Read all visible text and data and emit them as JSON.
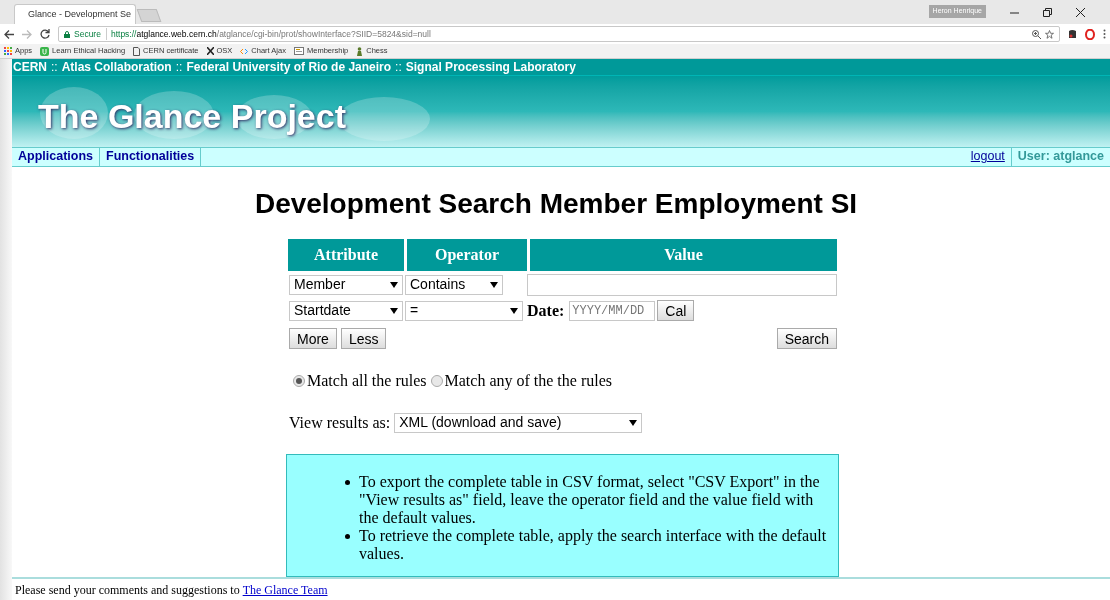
{
  "browser": {
    "tab_title": "Glance - Development Se",
    "profile": "Heron Henrique",
    "secure_label": "Secure",
    "url_scheme": "https://",
    "url_host": "atglance.web.cern.ch",
    "url_path": "/atglance/cgi-bin/prot/showInterface?SIID=5824&sid=null",
    "bookmarks": [
      {
        "kind": "apps",
        "label": "Apps"
      },
      {
        "kind": "badge",
        "label": "Learn Ethical Hacking"
      },
      {
        "kind": "page",
        "label": "CERN certificate"
      },
      {
        "kind": "x",
        "label": "OSX"
      },
      {
        "kind": "code",
        "label": "Chart Ajax"
      },
      {
        "kind": "card",
        "label": "Membership"
      },
      {
        "kind": "pawn",
        "label": "Chess"
      }
    ]
  },
  "header": {
    "credits": [
      {
        "kind": "link",
        "label": "CERN"
      },
      {
        "kind": "sep",
        "label": "::"
      },
      {
        "kind": "link",
        "label": "Atlas Collaboration"
      },
      {
        "kind": "sep",
        "label": "::"
      },
      {
        "kind": "link",
        "label": "Federal University of Rio de Janeiro"
      },
      {
        "kind": "sep",
        "label": "::"
      },
      {
        "kind": "link",
        "label": "Signal Processing Laboratory"
      }
    ],
    "logo_title": "The Glance Project"
  },
  "nav": {
    "items": [
      "Applications",
      "Functionalities"
    ],
    "logout": "logout",
    "user": "User: atglance"
  },
  "title": "Development Search Member Employment SI",
  "search": {
    "columns": [
      "Attribute",
      "Operator",
      "Value"
    ],
    "rows": [
      {
        "attribute": "Member",
        "operator": "Contains",
        "kind": "text"
      },
      {
        "attribute": "Startdate",
        "operator": "=",
        "kind": "date",
        "date_label": "Date:",
        "date_placeholder": "YYYY/MM/DD",
        "cal_button": "Cal"
      }
    ],
    "buttons": [
      "More",
      "Less"
    ],
    "search_button": "Search"
  },
  "match": [
    {
      "label": "Match all the rules",
      "selected": true
    },
    {
      "label": "Match any of the the rules",
      "selected": false
    }
  ],
  "view_results": {
    "label": "View results as:",
    "value": "XML (download and save)"
  },
  "tips": [
    "To export the complete table in CSV format, select \"CSV Export\" in the \"View results as\" field, leave the operator field and the value field with the default values.",
    "To retrieve the complete table, apply the search interface with the default values."
  ],
  "footer": {
    "text": "Please send your comments and suggestions to",
    "link": "The Glance Team"
  }
}
